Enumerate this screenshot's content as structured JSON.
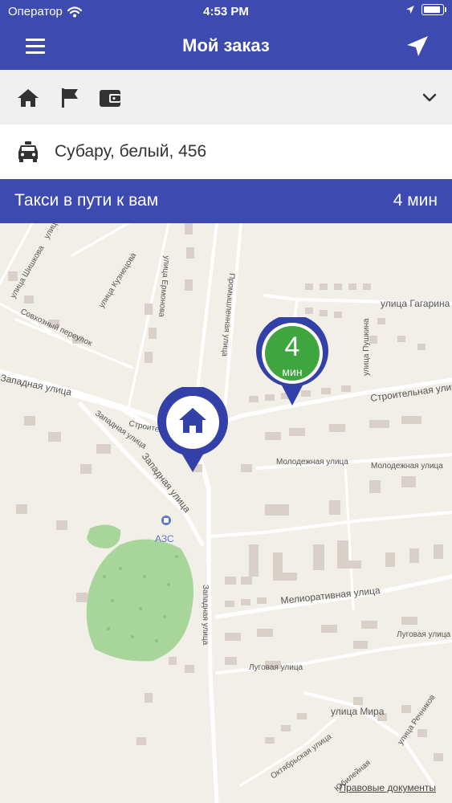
{
  "status_bar": {
    "carrier": "Оператор",
    "time": "4:53 PM"
  },
  "header": {
    "title": "Мой заказ",
    "menu_icon": "hamburger-menu-icon",
    "location_icon": "navigation-arrow-icon"
  },
  "toolbar": {
    "icons": [
      "home-icon",
      "flag-icon",
      "wallet-icon"
    ],
    "expand_icon": "chevron-down-icon"
  },
  "car": {
    "icon": "taxi-car-icon",
    "description": "Субару, белый, 456"
  },
  "status_banner": {
    "text": "Такси в пути к вам",
    "eta": "4 мин"
  },
  "map": {
    "streets": [
      "улица Шишкова",
      "улица Шишкова",
      "улица Кузнецова",
      "Совхозный переулок",
      "улица Ермонова",
      "Промышленная улица",
      "улица Гагарина",
      "улица Пушкина",
      "Строительная улица",
      "Западная улица",
      "Западная улица",
      "Западная улица",
      "Строител",
      "Молодежная улица",
      "Молодежная улица",
      "Мелиоративная улица",
      "Луговая улица",
      "Луговая улица",
      "Западная улица",
      "улица Мира",
      "Октябрьская улица",
      "улица Речников",
      "Юбилейная"
    ],
    "gas_station_label": "АЗС",
    "legal_link": "Правовые документы",
    "home_pin_icon": "home-icon",
    "eta_pin": {
      "value": "4",
      "unit": "мин",
      "color": "#3fa63f"
    },
    "pin_color": "#3340a8"
  },
  "colors": {
    "brand": "#3d4ab0",
    "map_background": "#f2efe9",
    "park": "#a8d59a"
  }
}
